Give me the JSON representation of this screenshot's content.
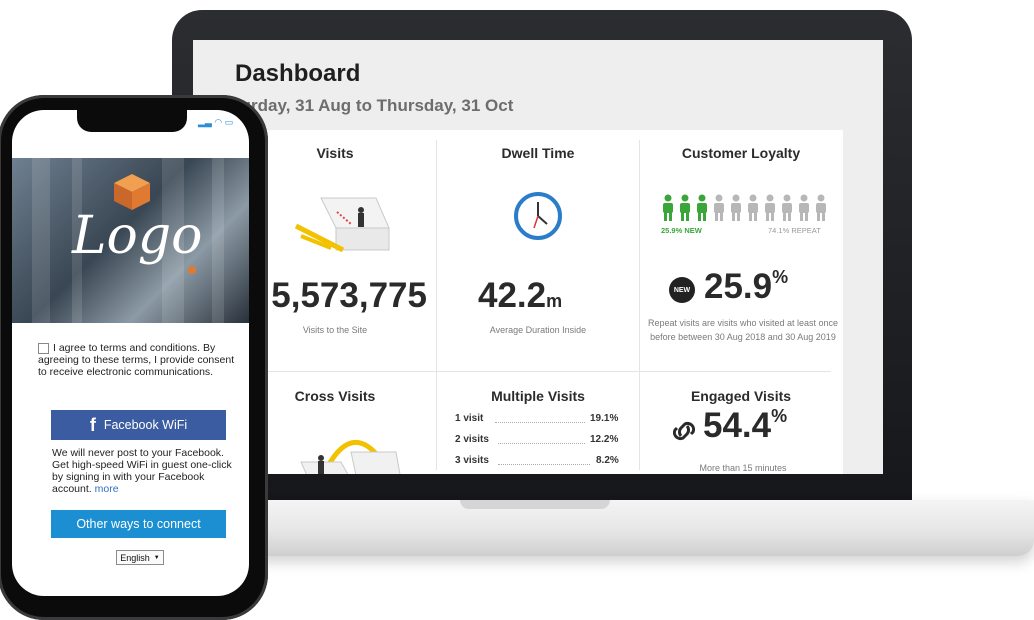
{
  "dashboard": {
    "title": "Dashboard",
    "date_range": "turday, 31 Aug to Thursday, 31 Oct"
  },
  "cards": {
    "visits": {
      "title": "Visits",
      "value": "5,573,775",
      "caption": "Visits to the Site"
    },
    "dwell": {
      "title": "Dwell Time",
      "value": "42.2",
      "unit": "m",
      "caption": "Average Duration Inside"
    },
    "loyalty": {
      "title": "Customer Loyalty",
      "new_label": "25.9% NEW",
      "repeat_label": "74.1% REPEAT",
      "value": "25.9",
      "unit": "%",
      "badge": "NEW",
      "caption": "Repeat visits are visits who visited at least once before between 30 Aug 2018 and 30 Aug 2019",
      "new_color": "#3aa63a",
      "repeat_color": "#b7b7b7"
    },
    "cross": {
      "title": "Cross Visits"
    },
    "multiple": {
      "title": "Multiple Visits",
      "rows": [
        {
          "label": "1 visit",
          "value": "19.1%"
        },
        {
          "label": "2 visits",
          "value": "12.2%"
        },
        {
          "label": "3 visits",
          "value": "8.2%"
        }
      ]
    },
    "engaged": {
      "title": "Engaged Visits",
      "value": "54.4",
      "unit": "%",
      "caption": "More than 15 minutes"
    }
  },
  "phone": {
    "logo_text": "Logo",
    "terms_text": "I agree to terms and conditions. By agreeing to these terms, I provide consent to receive electronic communications.",
    "facebook_button": "Facebook WiFi",
    "never_post": "We will never post to your Facebook. Get high-speed WiFi in guest one-click by signing in with your Facebook account.",
    "more_link": "more",
    "other_button": "Other ways to connect",
    "language": "English",
    "facebook_color": "#3b5ca0",
    "other_color": "#1b8fd1"
  }
}
